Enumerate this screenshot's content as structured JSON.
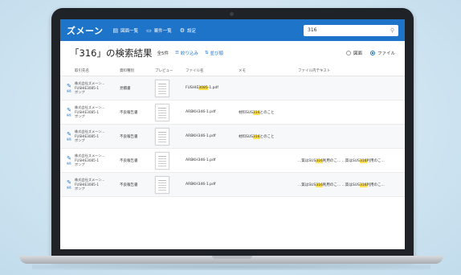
{
  "app": {
    "logo": "ズメーン",
    "nav": [
      {
        "icon": "list-icon",
        "label": "図面一覧"
      },
      {
        "icon": "folder-icon",
        "label": "案件一覧"
      },
      {
        "icon": "gear-icon",
        "label": "設定"
      }
    ],
    "search_value": "316"
  },
  "results": {
    "title": "「316」の検索結果",
    "count": "全5件",
    "filter_label": "絞り込み",
    "sort_label": "並び順",
    "toggle_options": [
      "図面",
      "ファイル"
    ],
    "toggle_selected": "ファイル"
  },
  "table": {
    "headers": [
      "取引先名",
      "資料種別",
      "プレビュー",
      "ファイル名",
      "メモ",
      "ファイル内テキスト"
    ],
    "edit_label": "編集",
    "rows": [
      {
        "company": "株式会社ズメーン...",
        "code": "FUSHIE3085-1",
        "item": "ポンプ",
        "type": "見積書",
        "file_pre": "FUSHIE",
        "file_hl": "3085",
        "file_post": "-1.pdf",
        "memo_pre": "",
        "memo_hl": "",
        "memo_post": "",
        "text1_pre": "",
        "text1_hl": "",
        "text1_post": "",
        "text2_pre": "",
        "text2_hl": "",
        "text2_post": ""
      },
      {
        "company": "株式会社ズメーン...",
        "code": "FUSHIE3085-1",
        "item": "ポンプ",
        "type": "不良報告書",
        "file_pre": "ARBKH",
        "file_hl": "",
        "file_post": "346-1.pdf",
        "memo_pre": "材料SUS",
        "memo_hl": "316",
        "memo_post": "とのこと",
        "text1_pre": "",
        "text1_hl": "",
        "text1_post": "",
        "text2_pre": "",
        "text2_hl": "",
        "text2_post": ""
      },
      {
        "company": "株式会社ズメーン...",
        "code": "FUSHIE3085-1",
        "item": "ポンプ",
        "type": "不良報告書",
        "file_pre": "ARBKH",
        "file_hl": "",
        "file_post": "346-1.pdf",
        "memo_pre": "材料SUS",
        "memo_hl": "316",
        "memo_post": "とのこと",
        "text1_pre": "",
        "text1_hl": "",
        "text1_post": "",
        "text2_pre": "",
        "text2_hl": "",
        "text2_post": ""
      },
      {
        "company": "株式会社ズメーン...",
        "code": "FUSHIE3085-1",
        "item": "ポンプ",
        "type": "不良報告書",
        "file_pre": "ARBKH",
        "file_hl": "",
        "file_post": "346-1.pdf",
        "memo_pre": "",
        "memo_hl": "",
        "memo_post": "",
        "text1_pre": "...質はSUS",
        "text1_hl": "316",
        "text1_post": "利用のこ...",
        "text2_pre": "...質はSUS",
        "text2_hl": "316",
        "text2_post": "利用のこ..."
      },
      {
        "company": "株式会社ズメーン...",
        "code": "FUSHIE3085-1",
        "item": "ポンプ",
        "type": "不良報告書",
        "file_pre": "ARBKH",
        "file_hl": "",
        "file_post": "346-1.pdf",
        "memo_pre": "",
        "memo_hl": "",
        "memo_post": "",
        "text1_pre": "...質はSUS",
        "text1_hl": "316",
        "text1_post": "利用のこ...",
        "text2_pre": "...質はSUS",
        "text2_hl": "316",
        "text2_post": "利用のこ..."
      }
    ]
  },
  "colors": {
    "header_blue": "#1e74c9",
    "highlight": "#ffe14d",
    "background": "#cfe4f1",
    "laptop_bezel": "#1f2226"
  }
}
